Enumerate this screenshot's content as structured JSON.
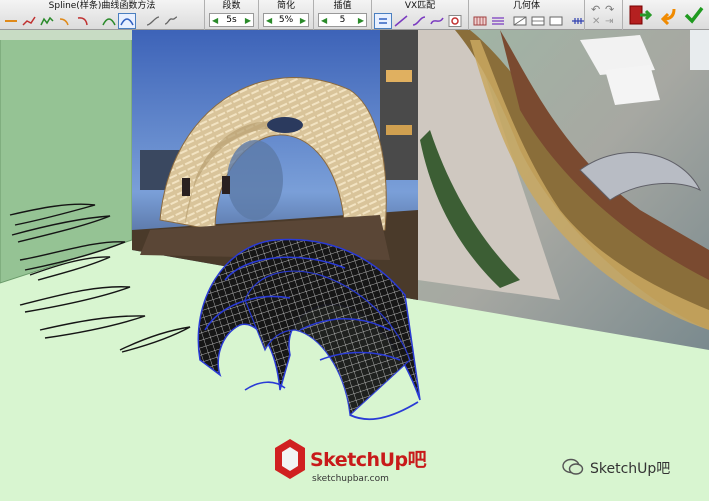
{
  "toolbar": {
    "spline_label": "Spline(样条)曲线函数方法",
    "segments_label": "段数",
    "segments_value": "5s",
    "simplify_label": "简化",
    "simplify_value": "5%",
    "interpolate_label": "插值",
    "interpolate_value": "5",
    "vx_label": "VX匹配",
    "geometry_label": "几何体"
  },
  "branding": {
    "logo_text": "SketchUp吧",
    "logo_url": "sketchupbar.com",
    "wechat_text": "SketchUp吧"
  },
  "colors": {
    "wall_green": "#95c394",
    "floor_green": "#d8f5d0",
    "mesh_edge": "#2a3bd6"
  }
}
